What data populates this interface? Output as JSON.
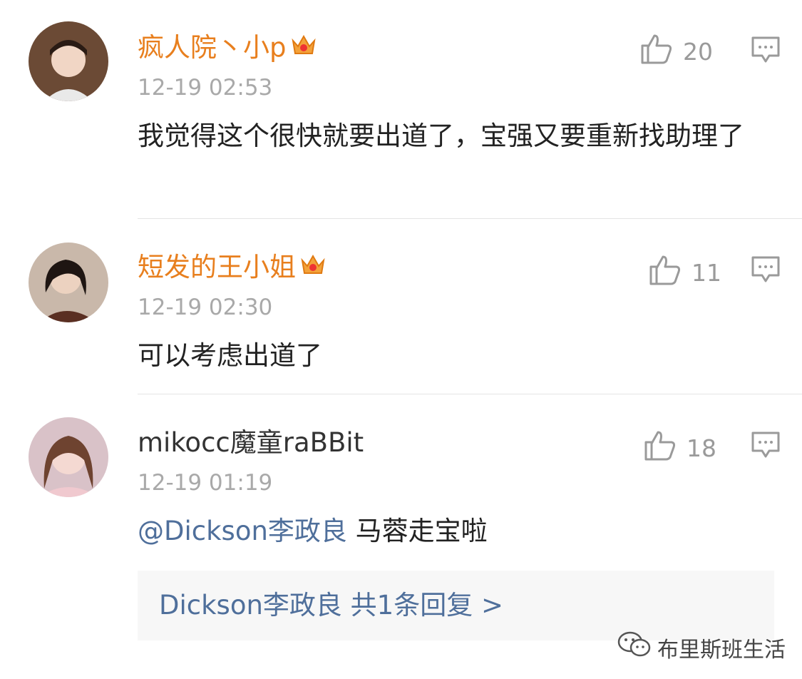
{
  "comments": [
    {
      "username": "疯人院丶小p",
      "time": "12-19 02:53",
      "text": "我觉得这个很快就要出道了，宝强又要重新找助理了",
      "likes": "20"
    },
    {
      "username": "短发的王小姐",
      "time": "12-19 02:30",
      "text": "可以考虑出道了",
      "likes": "11"
    },
    {
      "username": "mikocc魔童raBBit",
      "time": "12-19 01:19",
      "mention": "@Dickson李政良",
      "text": " 马蓉走宝啦",
      "likes": "18",
      "sub_reply": "Dickson李政良  共1条回复 >"
    }
  ],
  "watermark": "布里斯班生活",
  "icons": {
    "like": "thumbs-up-icon",
    "reply": "comment-icon",
    "badge": "crown-vip-icon",
    "watermark": "wechat-icon"
  },
  "colors": {
    "vip_name": "#e87f1e",
    "link": "#4f6f9b",
    "time": "#a9a9a9",
    "divider": "#e4e4e4"
  }
}
